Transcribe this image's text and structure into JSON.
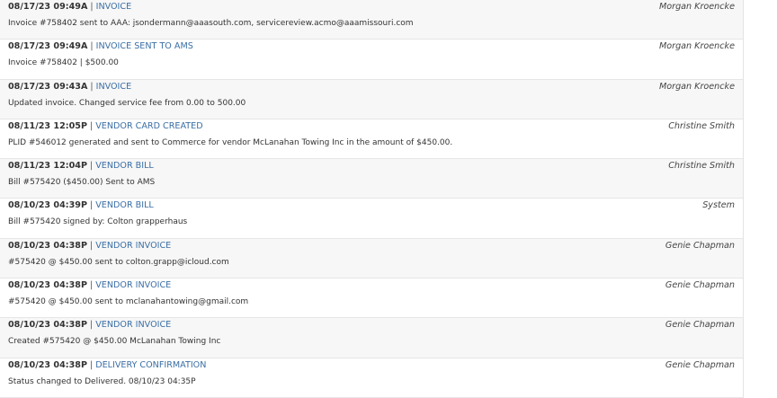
{
  "entries": [
    {
      "timestamp": "08/17/23 09:49A",
      "type": "INVOICE",
      "user": "Morgan Kroencke",
      "description": "Invoice #758402 sent to AAA: jsondermann@aaasouth.com, servicereview.acmo@aaamissouri.com"
    },
    {
      "timestamp": "08/17/23 09:49A",
      "type": "INVOICE SENT TO AMS",
      "user": "Morgan Kroencke",
      "description": "Invoice #758402 | $500.00"
    },
    {
      "timestamp": "08/17/23 09:43A",
      "type": "INVOICE",
      "user": "Morgan Kroencke",
      "description": "Updated invoice. Changed service fee from 0.00 to 500.00"
    },
    {
      "timestamp": "08/11/23 12:05P",
      "type": "VENDOR CARD CREATED",
      "user": "Christine Smith",
      "description": "PLID #546012 generated and sent to Commerce for vendor McLanahan Towing Inc in the amount of $450.00."
    },
    {
      "timestamp": "08/11/23 12:04P",
      "type": "VENDOR BILL",
      "user": "Christine Smith",
      "description": "Bill #575420 ($450.00) Sent to AMS"
    },
    {
      "timestamp": "08/10/23 04:39P",
      "type": "VENDOR BILL",
      "user": "System",
      "description": "Bill #575420 signed by: Colton grapperhaus"
    },
    {
      "timestamp": "08/10/23 04:38P",
      "type": "VENDOR INVOICE",
      "user": "Genie Chapman",
      "description": "#575420 @ $450.00 sent to colton.grapp@icloud.com"
    },
    {
      "timestamp": "08/10/23 04:38P",
      "type": "VENDOR INVOICE",
      "user": "Genie Chapman",
      "description": "#575420 @ $450.00 sent to mclanahantowing@gmail.com"
    },
    {
      "timestamp": "08/10/23 04:38P",
      "type": "VENDOR INVOICE",
      "user": "Genie Chapman",
      "description": "Created #575420 @ $450.00 McLanahan Towing Inc"
    },
    {
      "timestamp": "08/10/23 04:38P",
      "type": "DELIVERY CONFIRMATION",
      "user": "Genie Chapman",
      "description": "Status changed to Delivered. 08/10/23 04:35P"
    }
  ],
  "separator": "|",
  "colors": {
    "event_type": "#3a6ea5",
    "row_alt": "#f7f7f7",
    "border": "#e6e6e6"
  }
}
